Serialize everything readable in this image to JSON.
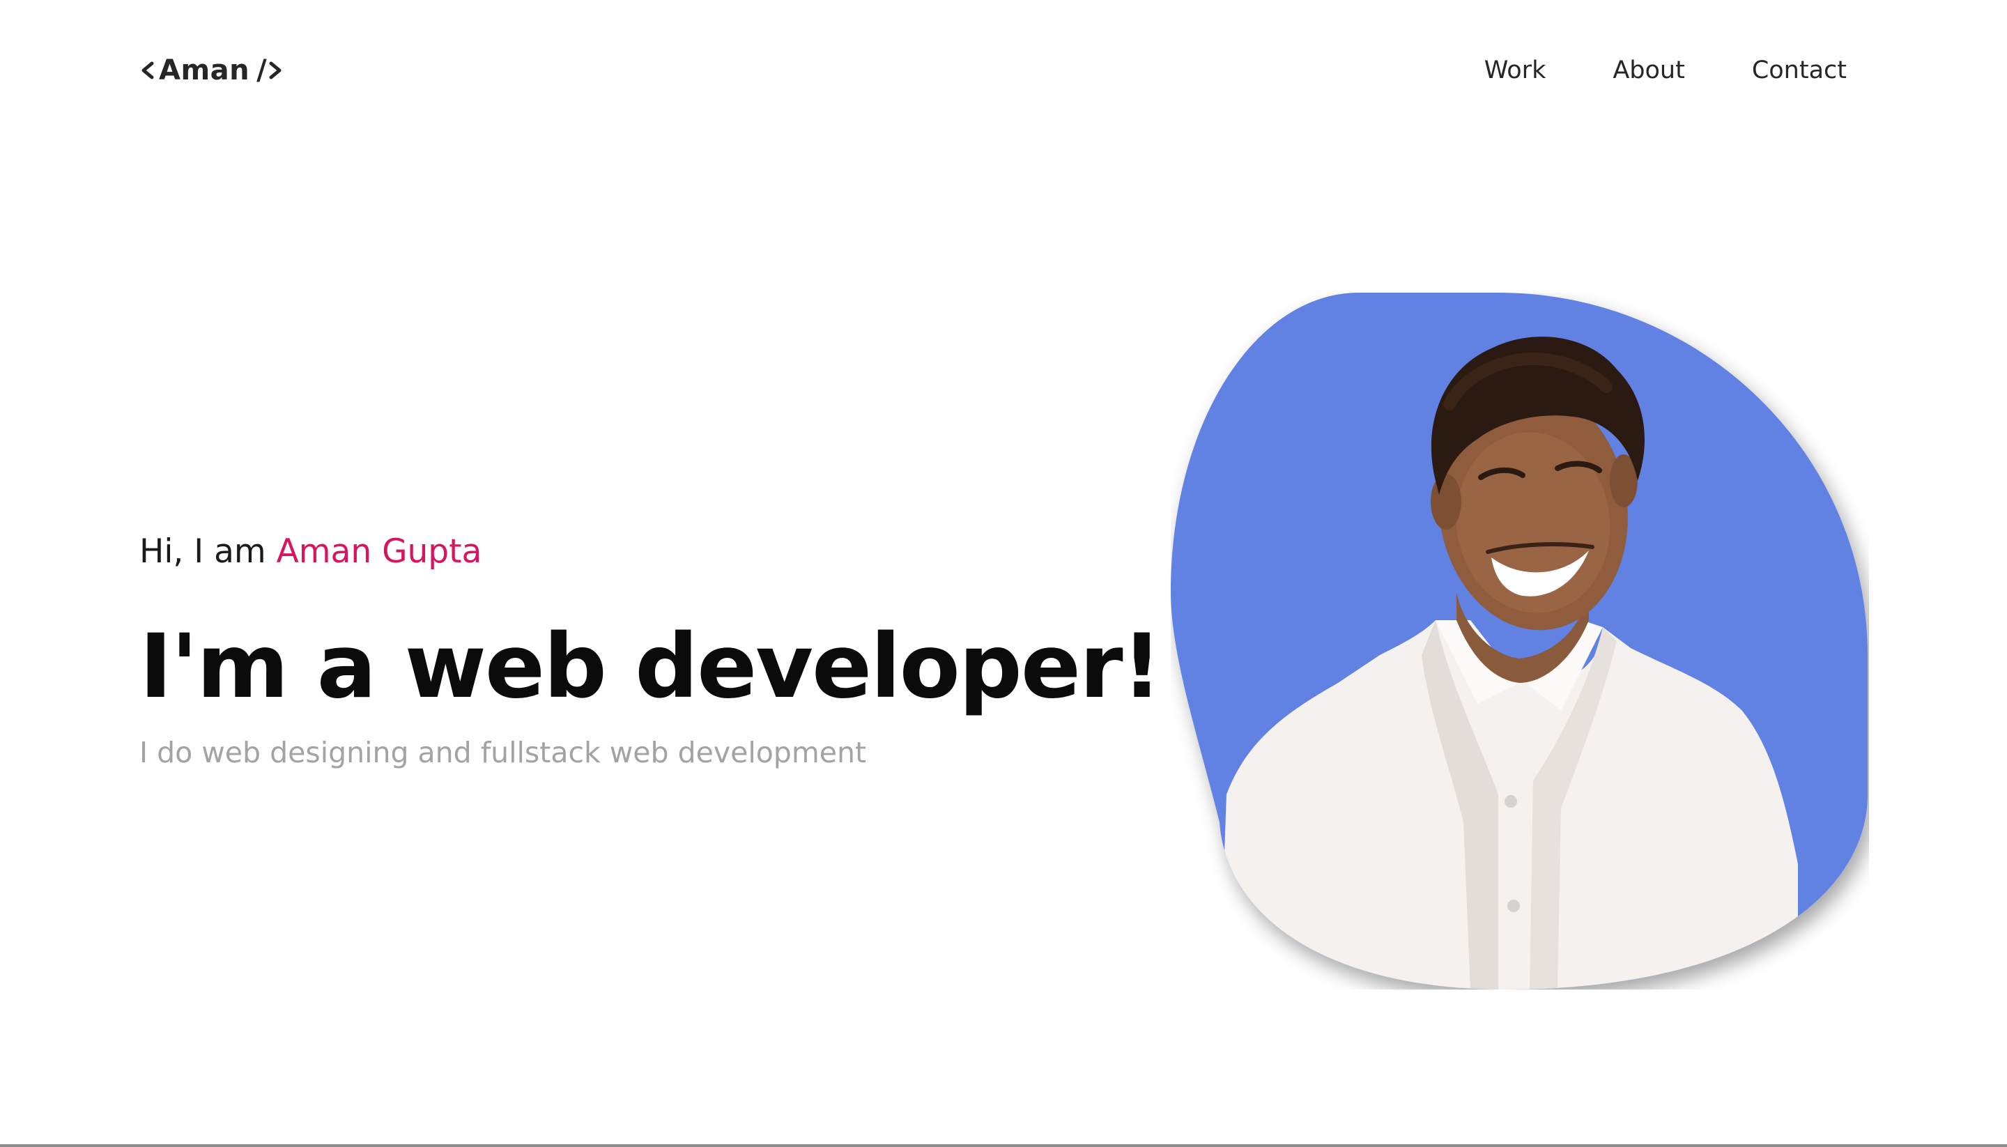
{
  "header": {
    "logo_text": "Aman",
    "logo_slash": "/",
    "nav": [
      {
        "label": "Work"
      },
      {
        "label": "About"
      },
      {
        "label": "Contact"
      }
    ]
  },
  "hero": {
    "greeting_prefix": "Hi, I am ",
    "greeting_name": "Aman Gupta",
    "headline": "I'm a web developer!",
    "subline": "I do web designing and fullstack web development"
  },
  "colors": {
    "accent": "#d6155e",
    "blob": "#6282e3",
    "text": "#0b0b0b",
    "muted": "#a3a3a3"
  }
}
